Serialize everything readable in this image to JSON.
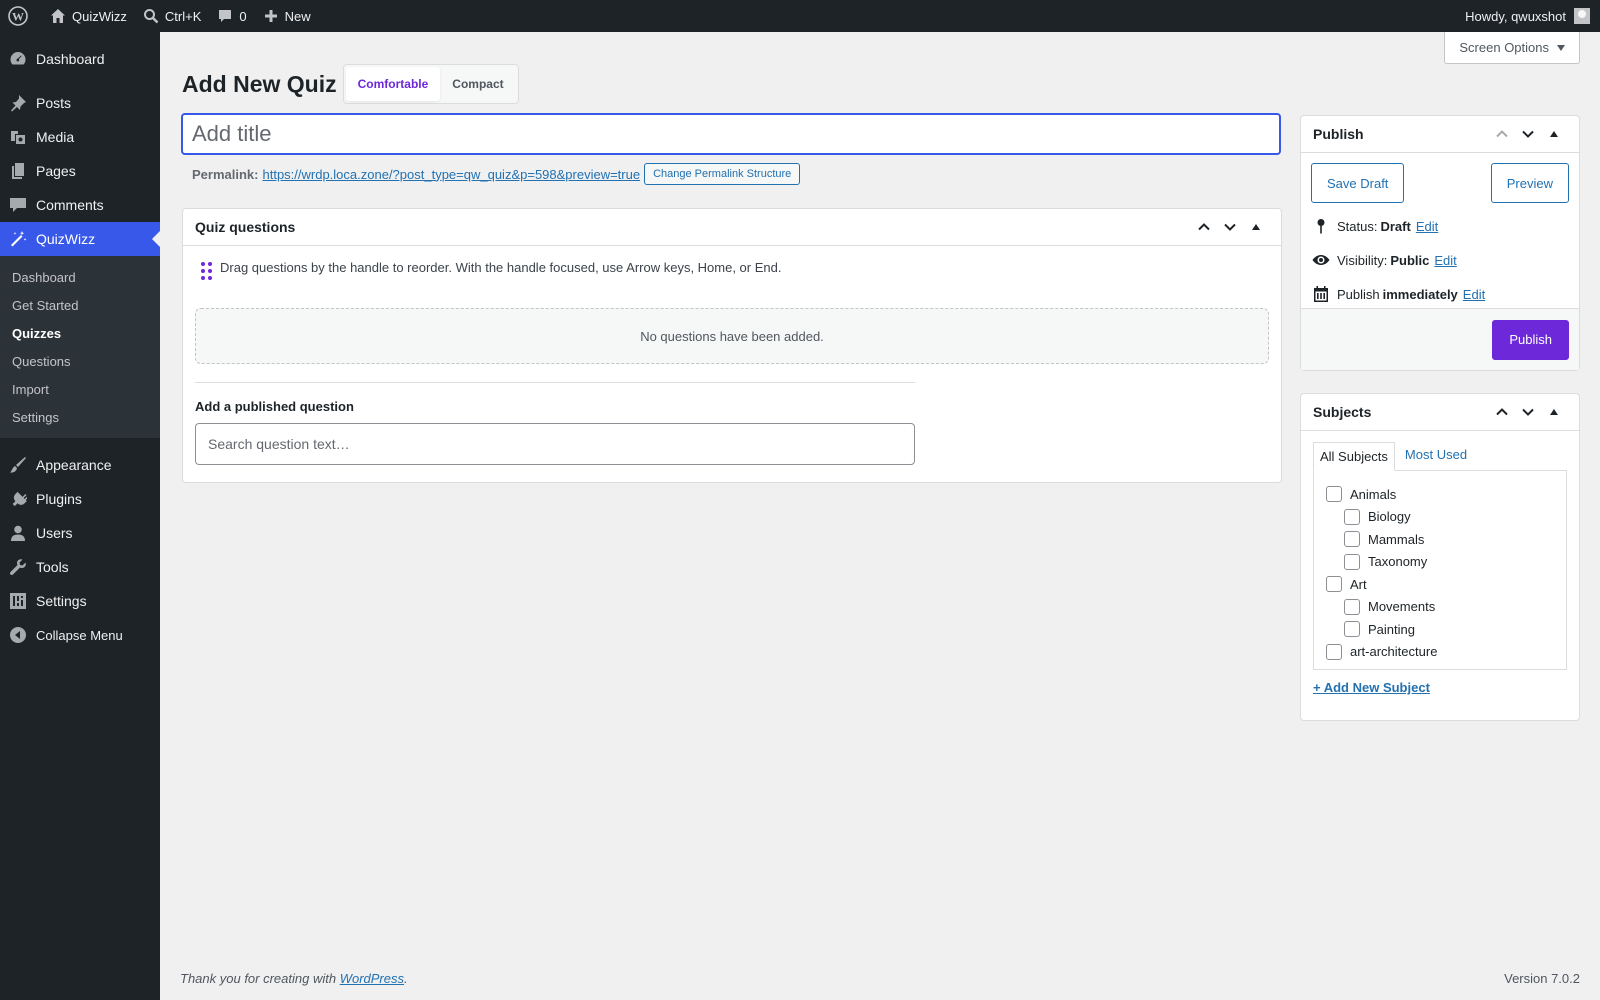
{
  "adminbar": {
    "site_name": "QuizWizz",
    "search_shortcut": "Ctrl+K",
    "comments_count": "0",
    "new_label": "New",
    "howdy": "Howdy, qwuxshot"
  },
  "sidebar": {
    "dashboard": "Dashboard",
    "posts": "Posts",
    "media": "Media",
    "pages": "Pages",
    "comments": "Comments",
    "quizwizz": "QuizWizz",
    "submenu": [
      "Dashboard",
      "Get Started",
      "Quizzes",
      "Questions",
      "Import",
      "Settings"
    ],
    "appearance": "Appearance",
    "plugins": "Plugins",
    "users": "Users",
    "tools": "Tools",
    "settings": "Settings",
    "collapse": "Collapse Menu"
  },
  "screen_options": "Screen Options",
  "page": {
    "title": "Add New Quiz",
    "density_comfortable": "Comfortable",
    "density_compact": "Compact",
    "title_placeholder": "Add title",
    "permalink_label": "Permalink:",
    "permalink_url": "https://wrdp.loca.zone/?post_type=qw_quiz&p=598&preview=true",
    "change_permalink": "Change Permalink Structure"
  },
  "quiz_questions": {
    "heading": "Quiz questions",
    "drag_hint": "Drag questions by the handle to reorder. With the handle focused, use Arrow keys, Home, or End.",
    "empty": "No questions have been added.",
    "add_label": "Add a published question",
    "search_placeholder": "Search question text…"
  },
  "publish": {
    "heading": "Publish",
    "save_draft": "Save Draft",
    "preview": "Preview",
    "status_label": "Status:",
    "status_value": "Draft",
    "visibility_label": "Visibility:",
    "visibility_value": "Public",
    "publish_label": "Publish",
    "publish_value": "immediately",
    "edit": "Edit",
    "publish_button": "Publish"
  },
  "subjects": {
    "heading": "Subjects",
    "tab_all": "All Subjects",
    "tab_most_used": "Most Used",
    "items": [
      {
        "label": "Animals",
        "child": false
      },
      {
        "label": "Biology",
        "child": true
      },
      {
        "label": "Mammals",
        "child": true
      },
      {
        "label": "Taxonomy",
        "child": true
      },
      {
        "label": "Art",
        "child": false
      },
      {
        "label": "Movements",
        "child": true
      },
      {
        "label": "Painting",
        "child": true
      },
      {
        "label": "art-architecture",
        "child": false
      }
    ],
    "add_new": "+ Add New Subject"
  },
  "footer": {
    "thanks_prefix": "Thank you for creating with ",
    "wordpress": "WordPress",
    "thanks_suffix": ".",
    "version": "Version 7.0.2"
  },
  "colors": {
    "admin_dark": "#1d2327",
    "menu_current": "#3858e9",
    "accent_purple": "#6d28d9",
    "link_blue": "#2271b1"
  }
}
